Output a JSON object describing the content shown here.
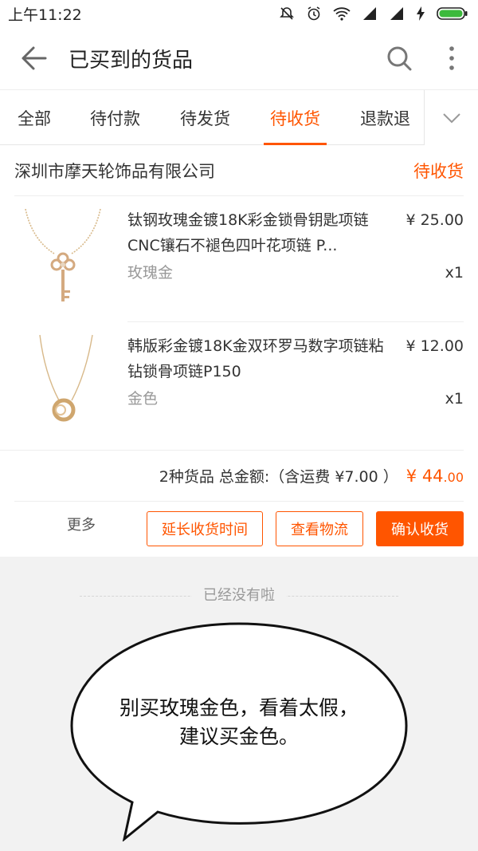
{
  "status_bar": {
    "time": "上午11:22"
  },
  "header": {
    "title": "已买到的货品",
    "back_icon": "arrow-left-icon",
    "search_icon": "search-icon",
    "menu_icon": "more-vertical-icon"
  },
  "tabs": [
    {
      "label": "全部",
      "active": false
    },
    {
      "label": "待付款",
      "active": false
    },
    {
      "label": "待发货",
      "active": false
    },
    {
      "label": "待收货",
      "active": true
    },
    {
      "label": "退款退",
      "active": false
    }
  ],
  "order": {
    "shop_name": "深圳市摩天轮饰品有限公司",
    "status": "待收货",
    "items": [
      {
        "title": "钛钢玫瑰金镀18K彩金锁骨钥匙项链 CNC镶石不褪色四叶花项链 P...",
        "price": "¥ 25.00",
        "sku": "玫瑰金",
        "qty": "x1"
      },
      {
        "title": "韩版彩金镀18K金双环罗马数字项链粘钻锁骨项链P150",
        "price": "¥ 12.00",
        "sku": "金色",
        "qty": "x1"
      }
    ],
    "summary": {
      "text": "2种货品 总金额:（含运费 ¥7.00 ）",
      "currency": "¥ ",
      "total_int": "44",
      "total_dec": ".00"
    },
    "actions": {
      "more": "更多",
      "extend": "延长收货时间",
      "logistics": "查看物流",
      "confirm": "确认收货"
    }
  },
  "footer": {
    "end_text": "已经没有啦"
  },
  "annotation": {
    "bubble_text": "别买玫瑰金色，看着太假，建议买金色。"
  },
  "colors": {
    "accent": "#ff5500",
    "background": "#f2f2f2"
  }
}
